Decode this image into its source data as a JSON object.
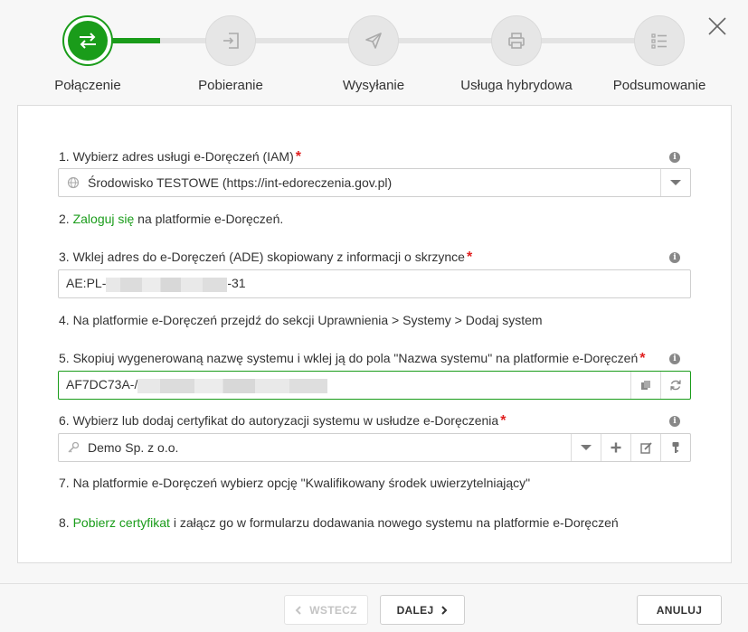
{
  "steps": [
    {
      "label": "Połączenie",
      "icon": "transfer-arrows-icon",
      "active": true
    },
    {
      "label": "Pobieranie",
      "icon": "sign-in-icon"
    },
    {
      "label": "Wysyłanie",
      "icon": "paper-plane-icon"
    },
    {
      "label": "Usługa hybrydowa",
      "icon": "printer-icon"
    },
    {
      "label": "Podsumowanie",
      "icon": "checklist-icon"
    }
  ],
  "form": {
    "s1": {
      "label": "1. Wybierz adres usługi e-Doręczeń (IAM)",
      "value": "Środowisko TESTOWE (https://int-edoreczenia.gov.pl)"
    },
    "s2": {
      "prefix": "2. ",
      "link": "Zaloguj się",
      "suffix": " na platformie e-Doręczeń."
    },
    "s3": {
      "label": "3. Wklej adres do e-Doręczeń (ADE) skopiowany z informacji o skrzynce",
      "value_start": "AE:PL-",
      "value_end": "-31"
    },
    "s4": {
      "text": "4. Na platformie e-Doręczeń przejdź do sekcji Uprawnienia > Systemy > Dodaj system"
    },
    "s5": {
      "label": "5. Skopiuj wygenerowaną nazwę systemu i wklej ją do pola \"Nazwa systemu\" na platformie e-Doręczeń",
      "value_start": "AF7DC73A-/"
    },
    "s6": {
      "label": "6. Wybierz lub dodaj certyfikat do autoryzacji systemu w usłudze e-Doręczenia",
      "value": "Demo Sp. z o.o."
    },
    "s7": {
      "text": "7. Na platformie e-Doręczeń wybierz opcję \"Kwalifikowany środek uwierzytelniający\""
    },
    "s8": {
      "prefix": "8. ",
      "link": "Pobierz certyfikat",
      "suffix": " i załącz go w formularzu dodawania nowego systemu na platformie e-Doręczeń"
    }
  },
  "footer": {
    "back_label": "WSTECZ",
    "next_label": "DALEJ",
    "cancel_label": "ANULUJ"
  },
  "colors": {
    "accent": "#1a9c1a",
    "required": "#e02020"
  }
}
